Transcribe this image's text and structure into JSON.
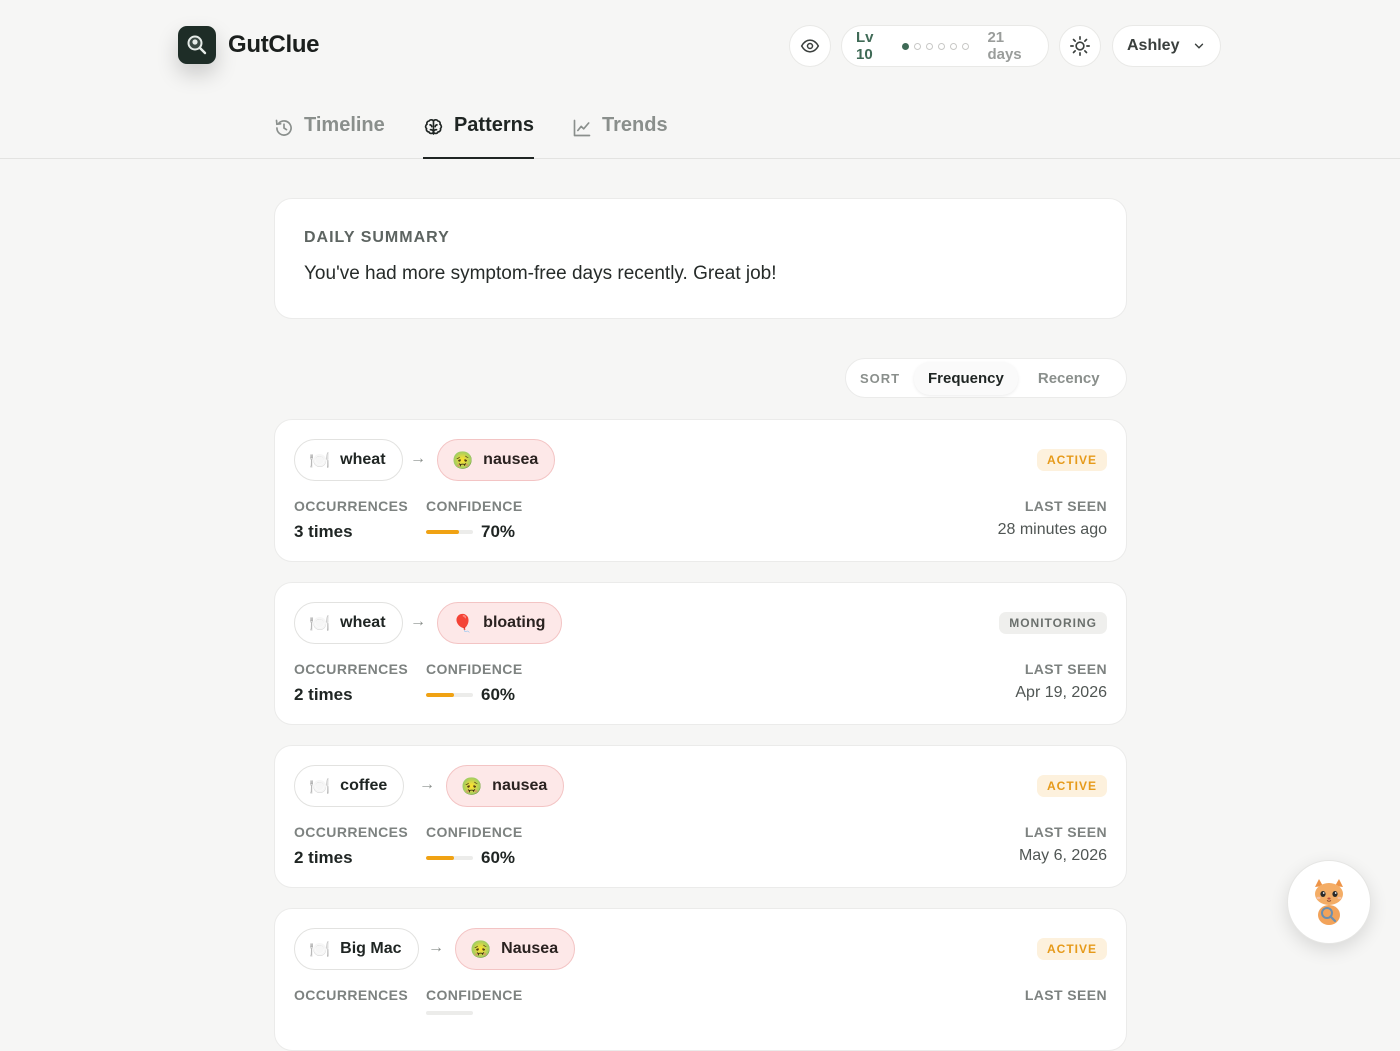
{
  "app": {
    "title": "GutClue"
  },
  "header": {
    "level_label": "Lv 10",
    "level_dots": {
      "filled": 1,
      "total": 6
    },
    "streak": "21 days",
    "user_name": "Ashley"
  },
  "tabs": [
    {
      "label": "Timeline",
      "icon": "history-icon",
      "active": false
    },
    {
      "label": "Patterns",
      "icon": "brain-icon",
      "active": true
    },
    {
      "label": "Trends",
      "icon": "line-chart-icon",
      "active": false
    }
  ],
  "summary": {
    "title": "DAILY SUMMARY",
    "text": "You've had more symptom-free days recently. Great job!"
  },
  "sort": {
    "label": "SORT",
    "options": [
      "Frequency",
      "Recency"
    ],
    "selected": "Frequency"
  },
  "labels": {
    "occurrences": "OCCURRENCES",
    "confidence": "CONFIDENCE",
    "last_seen": "LAST SEEN"
  },
  "patterns": [
    {
      "food": "wheat",
      "food_icon": "🍽️",
      "symptom": "nausea",
      "symptom_icon": "🤢",
      "status": "ACTIVE",
      "status_type": "active",
      "occurrences": "3 times",
      "confidence": "70%",
      "confidence_value": 0.7,
      "last_seen": "28 minutes ago"
    },
    {
      "food": "wheat",
      "food_icon": "🍽️",
      "symptom": "bloating",
      "symptom_icon": "🎈",
      "status": "MONITORING",
      "status_type": "monitoring",
      "occurrences": "2 times",
      "confidence": "60%",
      "confidence_value": 0.6,
      "last_seen": "Apr 19, 2026"
    },
    {
      "food": "coffee",
      "food_icon": "🍽️",
      "symptom": "nausea",
      "symptom_icon": "🤢",
      "status": "ACTIVE",
      "status_type": "active",
      "occurrences": "2 times",
      "confidence": "60%",
      "confidence_value": 0.6,
      "last_seen": "May 6, 2026"
    },
    {
      "food": "Big Mac",
      "food_icon": "🍽️",
      "symptom": "Nausea",
      "symptom_icon": "🤢",
      "status": "ACTIVE",
      "status_type": "active",
      "occurrences": "",
      "confidence": "",
      "confidence_value": 0,
      "last_seen": ""
    }
  ],
  "colors": {
    "accent_green": "#3f6a56",
    "active_orange": "#e69a1a",
    "symptom_pink": "#fde8e8"
  }
}
